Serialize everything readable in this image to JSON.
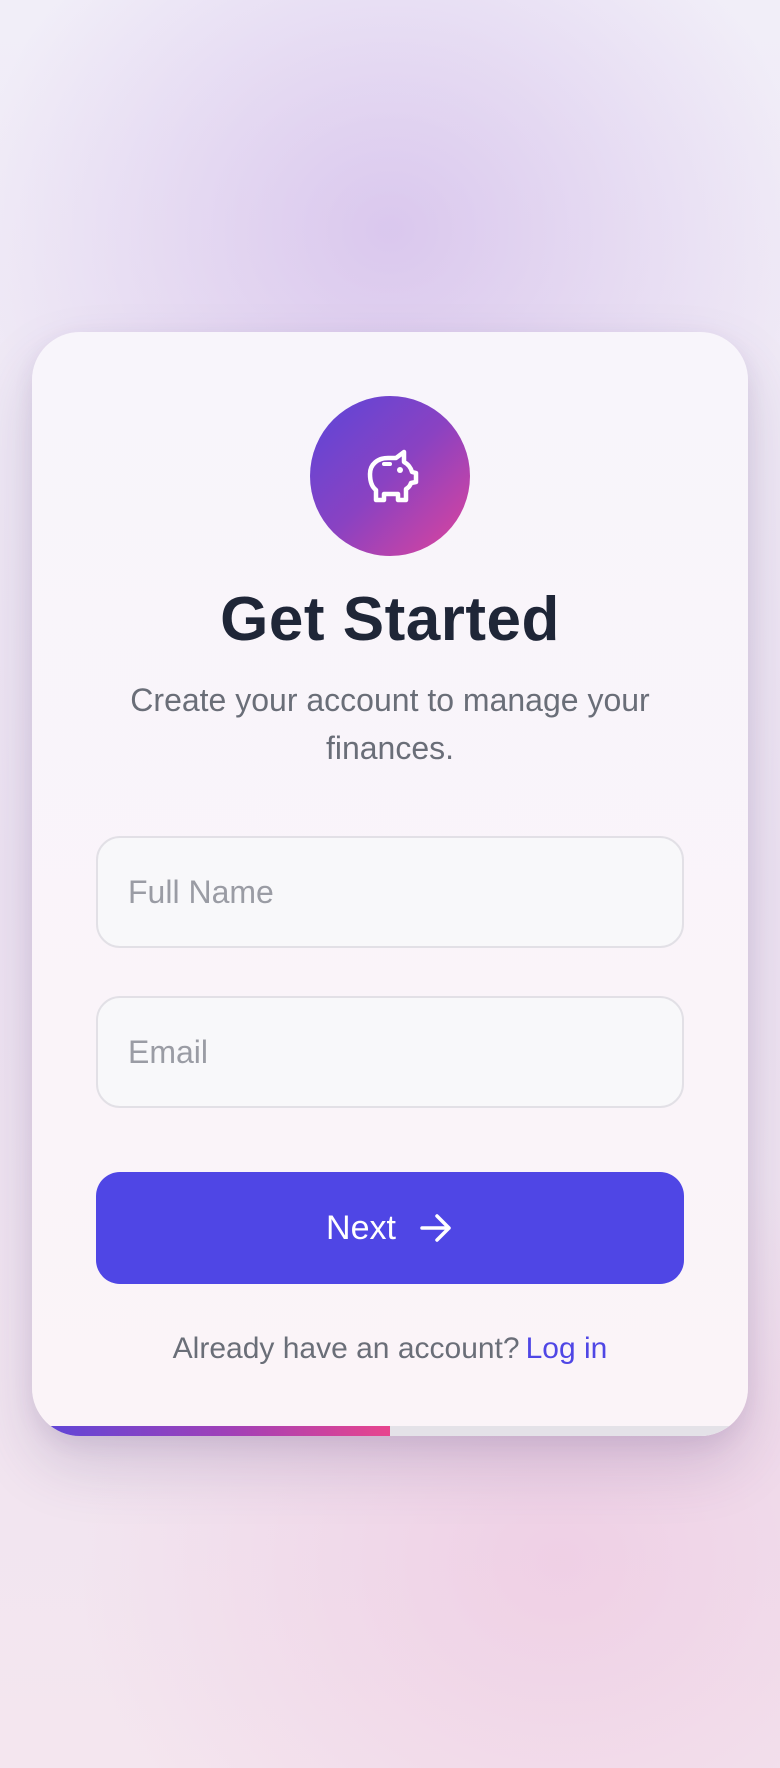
{
  "header": {
    "logo_icon": "piggy-bank-icon",
    "title": "Get Started",
    "subtitle": "Create your account to manage your finances."
  },
  "form": {
    "full_name": {
      "placeholder": "Full Name",
      "value": ""
    },
    "email": {
      "placeholder": "Email",
      "value": ""
    },
    "next_label": "Next",
    "next_icon": "arrow-right-icon"
  },
  "footer": {
    "prompt": "Already have an account?",
    "login_label": "Log in"
  },
  "progress": {
    "fraction": 0.5
  },
  "colors": {
    "accent": "#4f46e5",
    "gradient_start": "#5b46d9",
    "gradient_end": "#e0449a",
    "title": "#1f2637",
    "muted": "#6a6e78"
  }
}
